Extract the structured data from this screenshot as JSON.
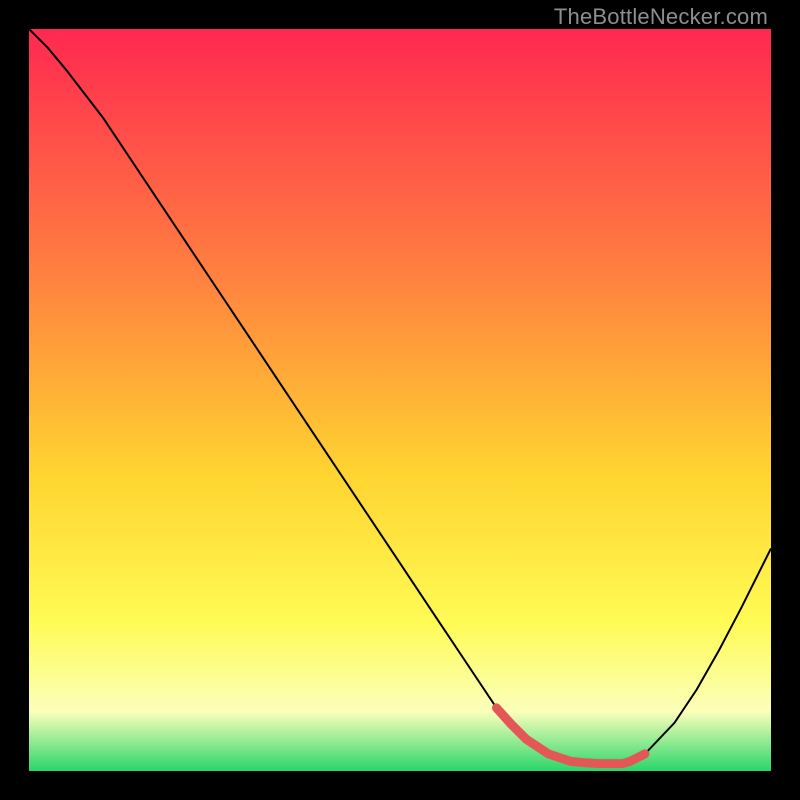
{
  "watermark": "TheBottleNecker.com",
  "chart_data": {
    "type": "line",
    "title": "",
    "xlabel": "",
    "ylabel": "",
    "xlim": [
      0,
      100
    ],
    "ylim": [
      0,
      100
    ],
    "background_gradient": {
      "stops": [
        {
          "offset": 0,
          "color": "#ff2850"
        },
        {
          "offset": 33,
          "color": "#ff8040"
        },
        {
          "offset": 60,
          "color": "#ffd430"
        },
        {
          "offset": 80,
          "color": "#fffb55"
        },
        {
          "offset": 92,
          "color": "#fbffbb"
        },
        {
          "offset": 100,
          "color": "#2ad66a"
        }
      ]
    },
    "series": [
      {
        "name": "curve",
        "color": "#000000",
        "width": 2,
        "x": [
          0,
          2.5,
          5,
          10,
          15,
          20,
          25,
          30,
          35,
          40,
          45,
          50,
          55,
          60,
          63,
          67,
          70,
          73,
          77,
          80,
          83,
          87,
          90,
          93,
          96,
          99,
          100
        ],
        "y": [
          100,
          97.5,
          94.5,
          88,
          80.5,
          73,
          65.5,
          58,
          50.5,
          43,
          35.5,
          28,
          20.5,
          13,
          8.5,
          4.3,
          2.3,
          1.3,
          1.0,
          1.0,
          2.3,
          6.5,
          11,
          16.3,
          22,
          28,
          30
        ]
      },
      {
        "name": "highlight",
        "color": "#e45757",
        "width": 9,
        "linecap": "round",
        "x": [
          63,
          65,
          67,
          70,
          73,
          75,
          77,
          79,
          80,
          81,
          83
        ],
        "y": [
          8.5,
          6.3,
          4.3,
          2.3,
          1.3,
          1.1,
          1.0,
          1.0,
          1.0,
          1.3,
          2.3
        ]
      }
    ]
  }
}
